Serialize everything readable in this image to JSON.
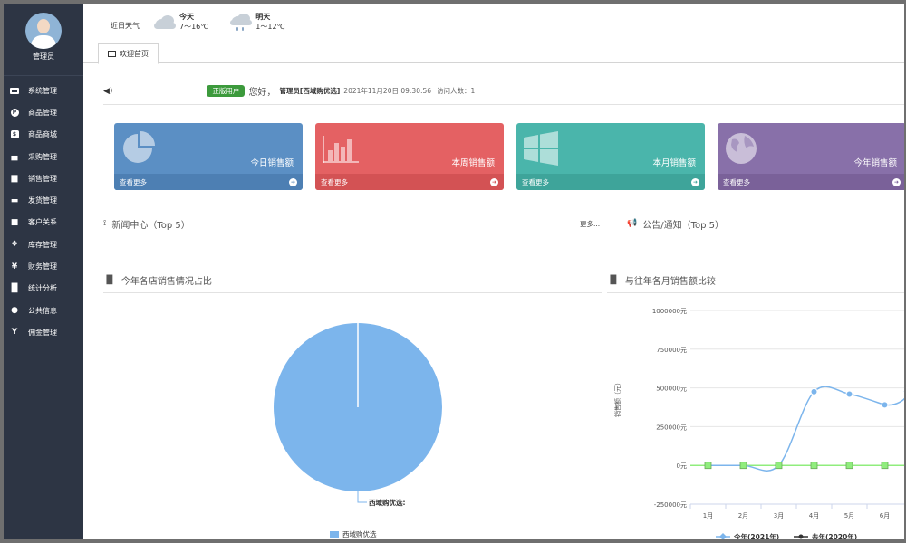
{
  "sidebar": {
    "user_name": "管理员",
    "items": [
      {
        "label": "系统管理",
        "icon": "monitor-icon"
      },
      {
        "label": "商品管理",
        "icon": "product-icon"
      },
      {
        "label": "商品商城",
        "icon": "store-icon"
      },
      {
        "label": "采购管理",
        "icon": "cart-icon"
      },
      {
        "label": "销售管理",
        "icon": "basket-icon"
      },
      {
        "label": "发货管理",
        "icon": "truck-icon"
      },
      {
        "label": "客户关系",
        "icon": "briefcase-icon"
      },
      {
        "label": "库存管理",
        "icon": "cubes-icon"
      },
      {
        "label": "财务管理",
        "icon": "yen-icon"
      },
      {
        "label": "统计分析",
        "icon": "bar-chart-icon"
      },
      {
        "label": "公共信息",
        "icon": "globe-icon"
      },
      {
        "label": "佣金管理",
        "icon": "fork-icon"
      }
    ]
  },
  "weather": {
    "label": "近日天气",
    "today": {
      "day": "今天",
      "temp": "7～16℃",
      "icon": "cloudy-icon"
    },
    "tomorrow": {
      "day": "明天",
      "temp": "1～12℃",
      "icon": "rain-icon"
    }
  },
  "tab": {
    "label": "欢迎首页"
  },
  "welcome": {
    "badge": "正版用户",
    "greeting": "您好，",
    "user": "管理员[西域购优选]",
    "datetime": "2021年11月20日 09:30:56",
    "visits": "访问人数：1"
  },
  "cards": [
    {
      "title": "今日销售额",
      "more": "查看更多",
      "color": "#5b8fc4",
      "icon": "pie-chart-icon"
    },
    {
      "title": "本周销售额",
      "more": "查看更多",
      "color": "#e46163",
      "icon": "bar-chart-icon"
    },
    {
      "title": "本月销售额",
      "more": "查看更多",
      "color": "#4ab5ab",
      "icon": "windows-icon"
    },
    {
      "title": "今年销售额",
      "more": "查看更多",
      "color": "#8870a9",
      "icon": "globe-icon"
    }
  ],
  "news": {
    "title": "新闻中心（Top 5）",
    "more": "更多..."
  },
  "notice": {
    "title": "公告/通知（Top 5）"
  },
  "pie_section": {
    "title": "今年各店销售情况占比"
  },
  "line_section": {
    "title": "与往年各月销售额比较"
  },
  "chart_data": [
    {
      "type": "pie",
      "title": "今年各店销售情况占比",
      "labels": [
        "西域购优选"
      ],
      "values": [
        100
      ],
      "colors": [
        "#7cb5ec"
      ],
      "slice_label": "西域购优选:",
      "legend": [
        "西域购优选"
      ]
    },
    {
      "type": "line",
      "title": "与往年各月销售额比较",
      "ylabel": "销售额（元）",
      "categories": [
        "1月",
        "2月",
        "3月",
        "4月",
        "5月",
        "6月"
      ],
      "ylim": [
        -250000,
        1000000
      ],
      "yticks": [
        "1000000元",
        "750000元",
        "500000元",
        "250000元",
        "0元",
        "-250000元"
      ],
      "ytick_values": [
        1000000,
        750000,
        500000,
        250000,
        0,
        -250000
      ],
      "series": [
        {
          "name": "今年(2021年)",
          "values": [
            0,
            0,
            0,
            475000,
            460000,
            390000
          ],
          "color": "#7cb5ec"
        },
        {
          "name": "去年(2020年)",
          "values": [
            0,
            0,
            0,
            0,
            0,
            0
          ],
          "color": "#90ed7d"
        }
      ]
    }
  ]
}
